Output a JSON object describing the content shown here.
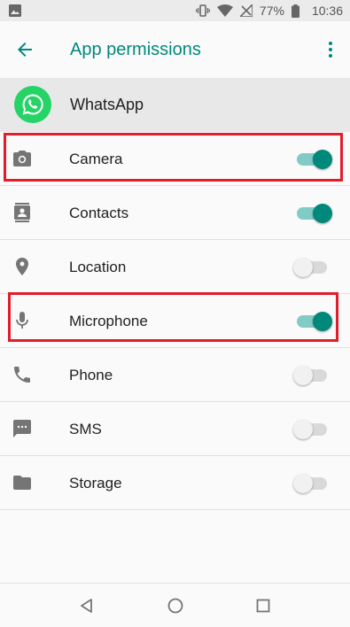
{
  "status_bar": {
    "battery_percent": "77%",
    "time": "10:36",
    "icons": [
      "image-notification-icon",
      "vibrate-icon",
      "wifi-icon",
      "no-signal-icon",
      "battery-icon"
    ]
  },
  "app_bar": {
    "title": "App permissions",
    "back_icon": "arrow-back-icon",
    "menu_icon": "more-vert-icon"
  },
  "app": {
    "name": "WhatsApp"
  },
  "permissions": [
    {
      "label": "Camera",
      "icon": "camera-icon",
      "enabled": true,
      "highlighted": true
    },
    {
      "label": "Contacts",
      "icon": "contacts-icon",
      "enabled": true,
      "highlighted": false
    },
    {
      "label": "Location",
      "icon": "location-icon",
      "enabled": false,
      "highlighted": false
    },
    {
      "label": "Microphone",
      "icon": "microphone-icon",
      "enabled": true,
      "highlighted": true
    },
    {
      "label": "Phone",
      "icon": "phone-icon",
      "enabled": false,
      "highlighted": false
    },
    {
      "label": "SMS",
      "icon": "sms-icon",
      "enabled": false,
      "highlighted": false
    },
    {
      "label": "Storage",
      "icon": "folder-icon",
      "enabled": false,
      "highlighted": false
    }
  ],
  "nav_bar": {
    "icons": [
      "back-triangle-icon",
      "home-circle-icon",
      "recents-square-icon"
    ]
  },
  "colors": {
    "accent": "#00897b",
    "highlight": "#e21c2a",
    "whatsapp_green": "#25d366"
  }
}
